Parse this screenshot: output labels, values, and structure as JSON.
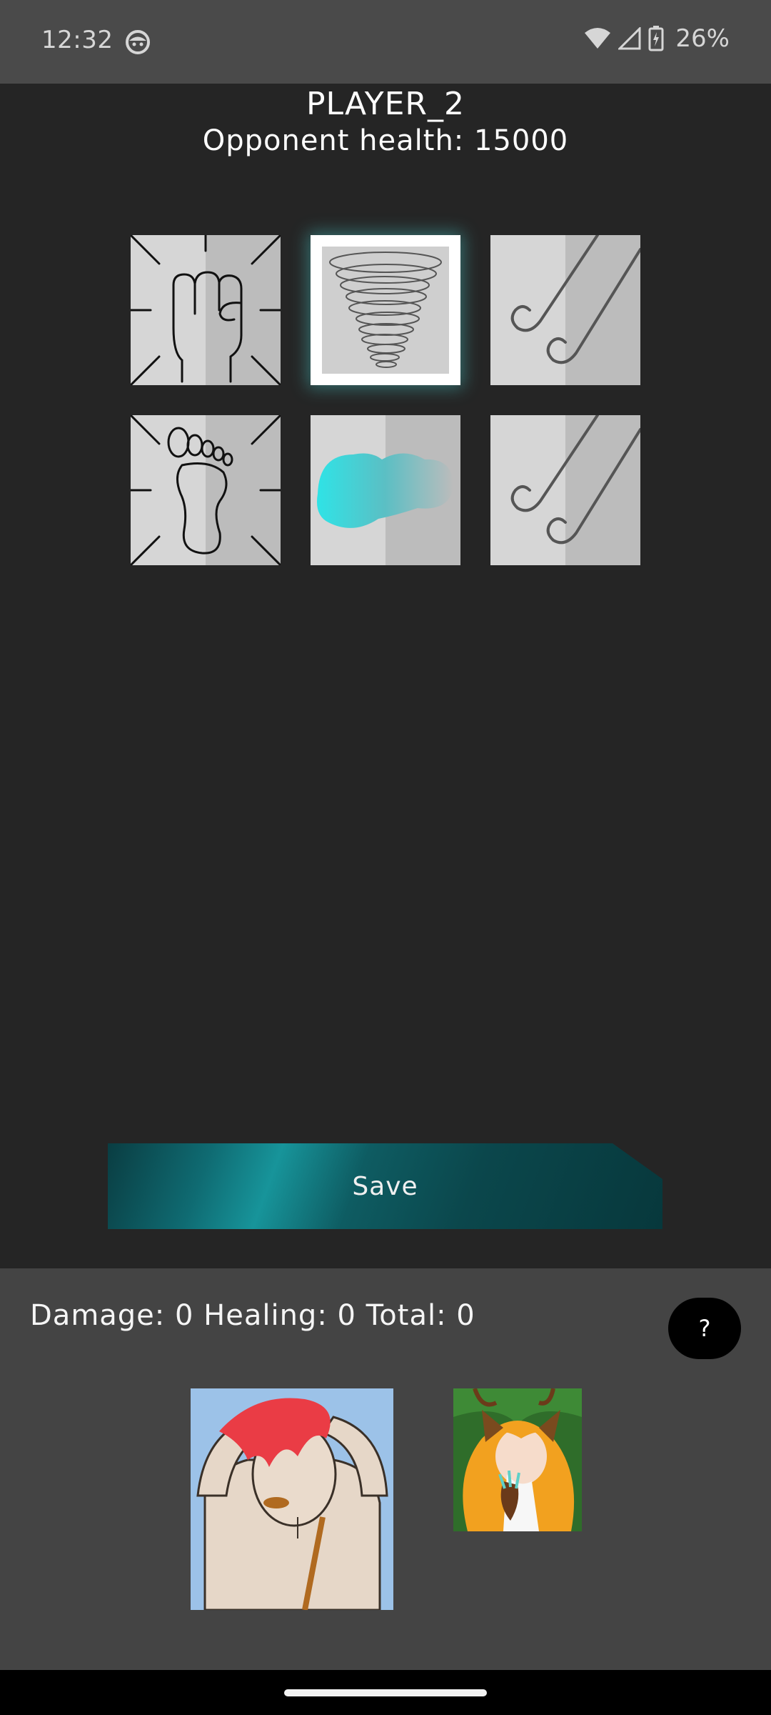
{
  "status_bar": {
    "time": "12:32",
    "battery": "26%",
    "icons": [
      "face-icon",
      "wifi-icon",
      "signal-icon",
      "battery-charging-icon"
    ]
  },
  "header": {
    "player_name": "PLAYER_2",
    "opponent_health": "Opponent health: 15000"
  },
  "abilities": [
    {
      "name": "punch-icon"
    },
    {
      "name": "tornado-icon",
      "selected": true
    },
    {
      "name": "wind-icon"
    },
    {
      "name": "kick-icon"
    },
    {
      "name": "water-splash-icon"
    },
    {
      "name": "wind-icon"
    }
  ],
  "actions": {
    "save_label": "Save"
  },
  "stats": {
    "text": "Damage: 0 Healing: 0 Total: 0"
  },
  "help": {
    "label": "?"
  },
  "characters": [
    {
      "name": "red-haired-fighter-portrait"
    },
    {
      "name": "fox-girl-portrait"
    }
  ],
  "colors": {
    "accent": "#17949a",
    "background": "#252525",
    "panel": "#444444"
  }
}
